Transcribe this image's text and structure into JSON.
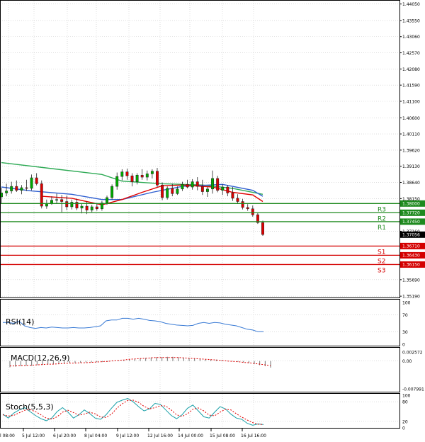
{
  "colors": {
    "background": "#ffffff",
    "frame": "#000000",
    "grid": "#c8c8c8",
    "bull": "#00aa00",
    "bear": "#dd0000",
    "ma_fast": "#e00000",
    "ma_mid": "#2f5fd0",
    "ma_slow": "#2eaa55",
    "resistance": "#1f8a1f",
    "support": "#d40000",
    "rsi_line": "#3a7bd5",
    "macd_hist": "#707070",
    "macd_signal": "#e00000",
    "stoch_main": "#1aa0a8",
    "stoch_signal": "#e00000"
  },
  "chart_data": [
    {
      "type": "candlestick",
      "title": "",
      "x_labels": [
        "5 Jul 12:00",
        "6 Jul 20:00",
        "8 Jul 04:00",
        "9 Jul 12:00",
        "12 Jul 16:00",
        "14 Jul 00:00",
        "15 Jul 08:00",
        "16 Jul 16:00"
      ],
      "x_label_partial": "l 08:00",
      "y_ticks": [
        "1.44050",
        "1.43550",
        "1.43060",
        "1.42570",
        "1.42080",
        "1.41590",
        "1.41100",
        "1.40600",
        "1.40110",
        "1.39620",
        "1.39130",
        "1.38640",
        "1.38150",
        "1.37160",
        "1.35690",
        "1.35190"
      ],
      "ylim": [
        1.3515,
        1.4415
      ],
      "grid": true,
      "candles": [
        {
          "o": 1.382,
          "h": 1.3848,
          "l": 1.38,
          "c": 1.3832
        },
        {
          "o": 1.3832,
          "h": 1.386,
          "l": 1.3822,
          "c": 1.3838
        },
        {
          "o": 1.3838,
          "h": 1.3866,
          "l": 1.383,
          "c": 1.3852
        },
        {
          "o": 1.3852,
          "h": 1.387,
          "l": 1.3835,
          "c": 1.384
        },
        {
          "o": 1.384,
          "h": 1.3856,
          "l": 1.3828,
          "c": 1.3848
        },
        {
          "o": 1.3848,
          "h": 1.3872,
          "l": 1.3838,
          "c": 1.3846
        },
        {
          "o": 1.3846,
          "h": 1.3888,
          "l": 1.384,
          "c": 1.3878
        },
        {
          "o": 1.3878,
          "h": 1.3892,
          "l": 1.3855,
          "c": 1.386
        },
        {
          "o": 1.386,
          "h": 1.387,
          "l": 1.3785,
          "c": 1.3792
        },
        {
          "o": 1.3792,
          "h": 1.3812,
          "l": 1.3784,
          "c": 1.38
        },
        {
          "o": 1.38,
          "h": 1.3822,
          "l": 1.3796,
          "c": 1.381
        },
        {
          "o": 1.381,
          "h": 1.383,
          "l": 1.38,
          "c": 1.3812
        },
        {
          "o": 1.3812,
          "h": 1.3826,
          "l": 1.3774,
          "c": 1.3806
        },
        {
          "o": 1.3806,
          "h": 1.3824,
          "l": 1.378,
          "c": 1.379
        },
        {
          "o": 1.379,
          "h": 1.3812,
          "l": 1.3782,
          "c": 1.3804
        },
        {
          "o": 1.3804,
          "h": 1.3814,
          "l": 1.378,
          "c": 1.3786
        },
        {
          "o": 1.3786,
          "h": 1.38,
          "l": 1.377,
          "c": 1.3792
        },
        {
          "o": 1.3792,
          "h": 1.3806,
          "l": 1.3768,
          "c": 1.378
        },
        {
          "o": 1.378,
          "h": 1.3796,
          "l": 1.3774,
          "c": 1.379
        },
        {
          "o": 1.379,
          "h": 1.3802,
          "l": 1.3778,
          "c": 1.3784
        },
        {
          "o": 1.3784,
          "h": 1.3808,
          "l": 1.3778,
          "c": 1.3802
        },
        {
          "o": 1.3802,
          "h": 1.3824,
          "l": 1.3796,
          "c": 1.3818
        },
        {
          "o": 1.3818,
          "h": 1.3858,
          "l": 1.3812,
          "c": 1.3852
        },
        {
          "o": 1.3852,
          "h": 1.3894,
          "l": 1.3842,
          "c": 1.3882
        },
        {
          "o": 1.3882,
          "h": 1.3904,
          "l": 1.387,
          "c": 1.3896
        },
        {
          "o": 1.3896,
          "h": 1.3906,
          "l": 1.3872,
          "c": 1.3884
        },
        {
          "o": 1.3884,
          "h": 1.3892,
          "l": 1.3852,
          "c": 1.3866
        },
        {
          "o": 1.3866,
          "h": 1.3892,
          "l": 1.3858,
          "c": 1.3886
        },
        {
          "o": 1.3886,
          "h": 1.3904,
          "l": 1.3872,
          "c": 1.388
        },
        {
          "o": 1.388,
          "h": 1.39,
          "l": 1.387,
          "c": 1.389
        },
        {
          "o": 1.389,
          "h": 1.3904,
          "l": 1.3876,
          "c": 1.3898
        },
        {
          "o": 1.3898,
          "h": 1.3908,
          "l": 1.385,
          "c": 1.3856
        },
        {
          "o": 1.3856,
          "h": 1.3864,
          "l": 1.381,
          "c": 1.3818
        },
        {
          "o": 1.3818,
          "h": 1.3852,
          "l": 1.3812,
          "c": 1.3846
        },
        {
          "o": 1.3846,
          "h": 1.386,
          "l": 1.3822,
          "c": 1.383
        },
        {
          "o": 1.383,
          "h": 1.3852,
          "l": 1.3826,
          "c": 1.3844
        },
        {
          "o": 1.3844,
          "h": 1.3866,
          "l": 1.3838,
          "c": 1.3858
        },
        {
          "o": 1.3858,
          "h": 1.3872,
          "l": 1.3846,
          "c": 1.385
        },
        {
          "o": 1.385,
          "h": 1.3874,
          "l": 1.3842,
          "c": 1.3866
        },
        {
          "o": 1.3866,
          "h": 1.388,
          "l": 1.384,
          "c": 1.3852
        },
        {
          "o": 1.3852,
          "h": 1.3872,
          "l": 1.3826,
          "c": 1.3836
        },
        {
          "o": 1.3836,
          "h": 1.385,
          "l": 1.382,
          "c": 1.3844
        },
        {
          "o": 1.3844,
          "h": 1.39,
          "l": 1.383,
          "c": 1.3876
        },
        {
          "o": 1.3876,
          "h": 1.3884,
          "l": 1.3834,
          "c": 1.384
        },
        {
          "o": 1.384,
          "h": 1.3858,
          "l": 1.3826,
          "c": 1.385
        },
        {
          "o": 1.385,
          "h": 1.3856,
          "l": 1.3822,
          "c": 1.3832
        },
        {
          "o": 1.3832,
          "h": 1.385,
          "l": 1.3808,
          "c": 1.3816
        },
        {
          "o": 1.3816,
          "h": 1.3828,
          "l": 1.38,
          "c": 1.3806
        },
        {
          "o": 1.3806,
          "h": 1.3814,
          "l": 1.3782,
          "c": 1.3788
        },
        {
          "o": 1.3788,
          "h": 1.3798,
          "l": 1.3778,
          "c": 1.3784
        },
        {
          "o": 1.3784,
          "h": 1.3794,
          "l": 1.376,
          "c": 1.3766
        },
        {
          "o": 1.3766,
          "h": 1.3772,
          "l": 1.3738,
          "c": 1.3742
        },
        {
          "o": 1.3742,
          "h": 1.3748,
          "l": 1.3702,
          "c": 1.3706
        }
      ],
      "moving_averages": [
        {
          "color_key": "ma_slow",
          "points": [
            [
              0,
              1.3924
            ],
            [
              10,
              1.3906
            ],
            [
              20,
              1.3888
            ],
            [
              24,
              1.3868
            ],
            [
              32,
              1.386
            ],
            [
              40,
              1.3856
            ],
            [
              46,
              1.3846
            ],
            [
              52,
              1.3828
            ]
          ]
        },
        {
          "color_key": "ma_mid",
          "points": [
            [
              0,
              1.385
            ],
            [
              6,
              1.3838
            ],
            [
              14,
              1.3828
            ],
            [
              20,
              1.3812
            ],
            [
              24,
              1.3812
            ],
            [
              30,
              1.3834
            ],
            [
              36,
              1.3852
            ],
            [
              44,
              1.3858
            ],
            [
              50,
              1.384
            ],
            [
              52,
              1.3822
            ]
          ]
        },
        {
          "color_key": "ma_fast",
          "points": [
            [
              8,
              1.3822
            ],
            [
              14,
              1.3816
            ],
            [
              20,
              1.3796
            ],
            [
              24,
              1.3812
            ],
            [
              28,
              1.3834
            ],
            [
              32,
              1.3854
            ],
            [
              36,
              1.3856
            ],
            [
              42,
              1.385
            ],
            [
              46,
              1.3834
            ],
            [
              50,
              1.3826
            ],
            [
              52,
              1.3806
            ]
          ]
        }
      ],
      "levels": [
        {
          "label": "R3",
          "value": "1.38000",
          "color_key": "resistance"
        },
        {
          "label": "R2",
          "value": "1.37720",
          "color_key": "resistance"
        },
        {
          "label": "R1",
          "value": "1.37450",
          "color_key": "resistance"
        },
        {
          "label": "S1",
          "value": "1.36710",
          "color_key": "support"
        },
        {
          "label": "S2",
          "value": "1.36430",
          "color_key": "support"
        },
        {
          "label": "S3",
          "value": "1.36150",
          "color_key": "support"
        }
      ],
      "current_price": "1.37056"
    },
    {
      "type": "line",
      "title": "RSI(14)",
      "ylim": [
        0,
        100
      ],
      "y_ticks": [
        "100",
        "70",
        "30",
        "0"
      ],
      "values": [
        52,
        52,
        50,
        55,
        44,
        40,
        38,
        40,
        39,
        41,
        40,
        39,
        39,
        40,
        39,
        39,
        40,
        42,
        44,
        56,
        58,
        58,
        62,
        62,
        60,
        62,
        60,
        57,
        56,
        54,
        50,
        48,
        46,
        45,
        44,
        45,
        50,
        52,
        50,
        52,
        51,
        48,
        46,
        44,
        40,
        36,
        34,
        30,
        30
      ]
    },
    {
      "type": "bar",
      "title": "MACD(12,26,9)",
      "ylim": [
        -0.007991,
        0.002572
      ],
      "y_ticks": [
        "0.002572",
        "0.00",
        "-0.007991"
      ],
      "histogram": [
        -0.0018,
        -0.0016,
        -0.0015,
        -0.0014,
        -0.0014,
        -0.0012,
        -0.0011,
        -0.001,
        -0.0009,
        -0.0008,
        -0.0007,
        -0.0006,
        -0.0006,
        -0.0005,
        -0.0004,
        -0.0004,
        -0.0003,
        -0.0003,
        -0.0002,
        -0.0001,
        0.0001,
        0.0002,
        0.0004,
        0.0006,
        0.0008,
        0.0009,
        0.001,
        0.0011,
        0.0011,
        0.0012,
        0.0012,
        0.0011,
        0.001,
        0.0009,
        0.0008,
        0.0007,
        0.0006,
        0.0005,
        0.0004,
        0.0002,
        0.0001,
        -0.0001,
        -0.0002,
        -0.0004,
        -0.0006,
        -0.0009,
        -0.0012,
        -0.0015,
        -0.0019
      ],
      "signal": [
        -0.0014,
        -0.0014,
        -0.0013,
        -0.0013,
        -0.0012,
        -0.0011,
        -0.001,
        -0.0009,
        -0.0009,
        -0.0008,
        -0.0007,
        -0.0006,
        -0.0006,
        -0.0005,
        -0.0005,
        -0.0004,
        -0.0003,
        -0.0002,
        -0.0001,
        0.0001,
        0.0002,
        0.0003,
        0.0005,
        0.0006,
        0.0007,
        0.0008,
        0.0009,
        0.001,
        0.001,
        0.001,
        0.001,
        0.001,
        0.0009,
        0.0008,
        0.0007,
        0.0006,
        0.0005,
        0.0004,
        0.0003,
        0.0002,
        0.0,
        -0.0001,
        -0.0002,
        -0.0004,
        -0.0005,
        -0.0007,
        -0.0009,
        -0.0011,
        -0.0013
      ]
    },
    {
      "type": "line",
      "title": "Stoch(5,5,3)",
      "ylim": [
        0,
        100
      ],
      "y_ticks": [
        "100",
        "80",
        "20",
        "0"
      ],
      "series": [
        {
          "values": [
            42,
            30,
            45,
            55,
            62,
            50,
            38,
            28,
            22,
            30,
            50,
            62,
            48,
            30,
            40,
            55,
            44,
            30,
            26,
            40,
            60,
            78,
            85,
            90,
            80,
            65,
            52,
            58,
            75,
            72,
            55,
            38,
            28,
            40,
            60,
            70,
            52,
            34,
            30,
            48,
            65,
            58,
            42,
            30,
            26,
            14,
            8,
            12,
            10
          ]
        },
        {
          "values": [
            40,
            36,
            38,
            46,
            54,
            56,
            50,
            40,
            30,
            27,
            34,
            48,
            54,
            47,
            39,
            42,
            48,
            43,
            33,
            32,
            42,
            60,
            74,
            84,
            85,
            78,
            66,
            58,
            62,
            68,
            67,
            55,
            40,
            35,
            43,
            57,
            61,
            52,
            39,
            37,
            48,
            57,
            55,
            43,
            33,
            24,
            16,
            11,
            10
          ]
        }
      ]
    }
  ]
}
